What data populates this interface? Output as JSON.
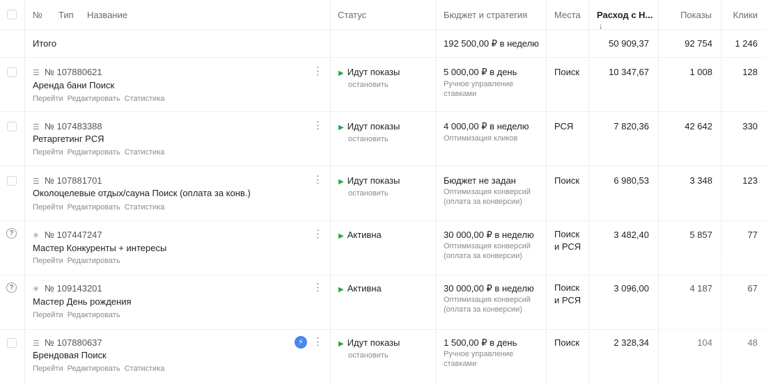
{
  "header": {
    "num": "№",
    "type": "Тип",
    "name": "Название",
    "status": "Статус",
    "budget": "Бюджет и стратегия",
    "places": "Места",
    "spend": "Расход с Н...",
    "sort_icon": "↓",
    "shows": "Показы",
    "clicks": "Клики"
  },
  "total": {
    "label": "Итого",
    "budget": "192 500,00 ₽ в неделю",
    "spend": "50 909,37",
    "shows": "92 754",
    "clicks": "1 246"
  },
  "campaigns": [
    {
      "id": "№ 107880621",
      "type_icon": "text-campaign-icon",
      "name": "Аренда бани Поиск",
      "links": [
        "Перейти",
        "Редактировать",
        "Статистика"
      ],
      "status": "Идут показы",
      "stop": "остановить",
      "budget": "5 000,00 ₽ в день",
      "strategy": "Ручное управление ставками",
      "places": "Поиск",
      "spend": "10 347,67",
      "shows": "1 008",
      "clicks": "128"
    },
    {
      "id": "№ 107483388",
      "type_icon": "text-campaign-icon",
      "name": "Ретаргетинг РСЯ",
      "links": [
        "Перейти",
        "Редактировать",
        "Статистика"
      ],
      "status": "Идут показы",
      "stop": "остановить",
      "budget": "4 000,00 ₽ в неделю",
      "strategy": "Оптимизация кликов",
      "places": "РСЯ",
      "spend": "7 820,36",
      "shows": "42 642",
      "clicks": "330"
    },
    {
      "id": "№ 107881701",
      "type_icon": "text-campaign-icon",
      "name": "Околоцелевые отдых/сауна Поиск (оплата за конв.)",
      "links": [
        "Перейти",
        "Редактировать",
        "Статистика"
      ],
      "status": "Идут показы",
      "stop": "остановить",
      "budget": "Бюджет не задан",
      "strategy": "Оптимизация конверсий (оплата за конверсии)",
      "places": "Поиск",
      "spend": "6 980,53",
      "shows": "3 348",
      "clicks": "123"
    },
    {
      "id": "№ 107447247",
      "type_icon": "master-campaign-icon",
      "name": "Мастер Конкуренты + интересы",
      "links": [
        "Перейти",
        "Редактировать"
      ],
      "status": "Активна",
      "stop": "",
      "budget": "30 000,00 ₽ в неделю",
      "strategy": "Оптимизация конверсий (оплата за конверсии)",
      "places": "Поиск и РСЯ",
      "spend": "3 482,40",
      "shows": "5 857",
      "clicks": "77"
    },
    {
      "id": "№ 109143201",
      "type_icon": "master-campaign-icon",
      "name": "Мастер День рождения",
      "links": [
        "Перейти",
        "Редактировать"
      ],
      "status": "Активна",
      "stop": "",
      "budget": "30 000,00 ₽ в неделю",
      "strategy": "Оптимизация конверсий (оплата за конверсии)",
      "places": "Поиск и РСЯ",
      "spend": "3 096,00",
      "shows": "4 187",
      "clicks": "67"
    },
    {
      "id": "№ 107880637",
      "type_icon": "text-campaign-icon",
      "name": "Брендовая Поиск",
      "links": [
        "Перейти",
        "Редактировать",
        "Статистика"
      ],
      "status": "Идут показы",
      "stop": "остановить",
      "budget": "1 500,00 ₽ в день",
      "strategy": "Ручное управление ставками",
      "places": "Поиск",
      "spend": "2 328,34",
      "shows": "104",
      "clicks": "48"
    }
  ]
}
